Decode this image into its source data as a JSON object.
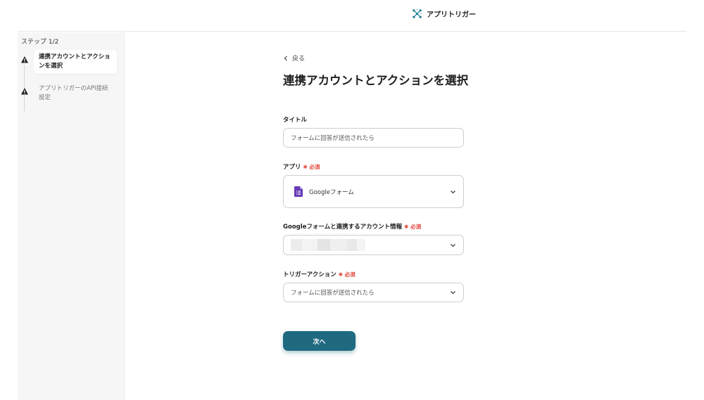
{
  "header": {
    "brand": "アプリトリガー",
    "logo_icon": "app-trigger-logo-icon"
  },
  "sidebar": {
    "step_counter": "ステップ 1/2",
    "steps": [
      {
        "label": "連携アカウントとアクションを選択",
        "status_icon": "warning-icon",
        "active": true
      },
      {
        "label": "アプリトリガーのAPI接続設定",
        "status_icon": "warning-icon",
        "active": false
      }
    ]
  },
  "main": {
    "back_label": "戻る",
    "title": "連携アカウントとアクションを選択",
    "fields": {
      "title": {
        "label": "タイトル",
        "value": "フォームに回答が送信されたら"
      },
      "app": {
        "label": "アプリ",
        "required": "必須",
        "value": "Googleフォーム",
        "icon": "google-forms-icon"
      },
      "account": {
        "label": "Googleフォームと連携するアカウント情報",
        "required": "必須",
        "value": ""
      },
      "trigger_action": {
        "label": "トリガーアクション",
        "required": "必須",
        "value": "フォームに回答が送信されたら"
      }
    },
    "next_label": "次へ"
  },
  "colors": {
    "accent": "#1f6a80",
    "required": "#e0463c",
    "forms_purple": "#673ab7"
  }
}
